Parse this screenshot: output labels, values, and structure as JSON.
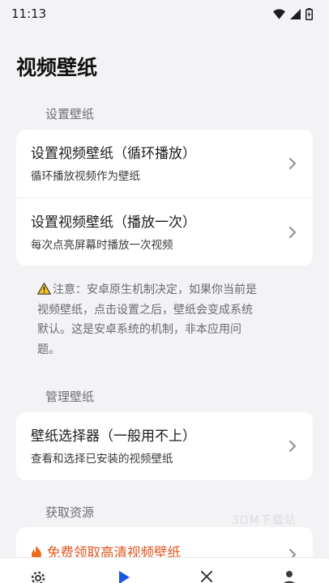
{
  "status_bar": {
    "time": "11:13",
    "icons": [
      "wifi-icon",
      "signal-icon",
      "battery-charging-icon"
    ]
  },
  "page_title": "视频壁纸",
  "sections": [
    {
      "label": "设置壁纸",
      "items": [
        {
          "title": "设置视频壁纸（循环播放）",
          "subtitle": "循环播放视频作为壁纸"
        },
        {
          "title": "设置视频壁纸（播放一次）",
          "subtitle": "每次点亮屏幕时播放一次视频"
        }
      ]
    },
    {
      "label": "管理壁纸",
      "items": [
        {
          "title": "壁纸选择器（一般用不上）",
          "subtitle": "查看和选择已安装的视频壁纸"
        }
      ]
    },
    {
      "label": "获取资源",
      "items": [
        {
          "title": "免费领取高清视频壁纸",
          "icon": "fire-icon"
        }
      ]
    }
  ],
  "notice": {
    "lines": [
      "注意：安卓原生机制决定，如果你当前是",
      "视频壁纸，点击设置之后，壁纸会变成系统",
      "默认。这是安卓系统的机制，非本应用问",
      "题。"
    ],
    "icon": "warning-icon"
  },
  "watermark": "3DM下载站",
  "bottom_nav": [
    "settings-icon",
    "play-icon",
    "close-icon",
    "user-icon"
  ],
  "colors": {
    "background": "#f3f3f5",
    "card": "#ffffff",
    "accent": "#e2561f",
    "secondary_text": "#6f6f74"
  }
}
